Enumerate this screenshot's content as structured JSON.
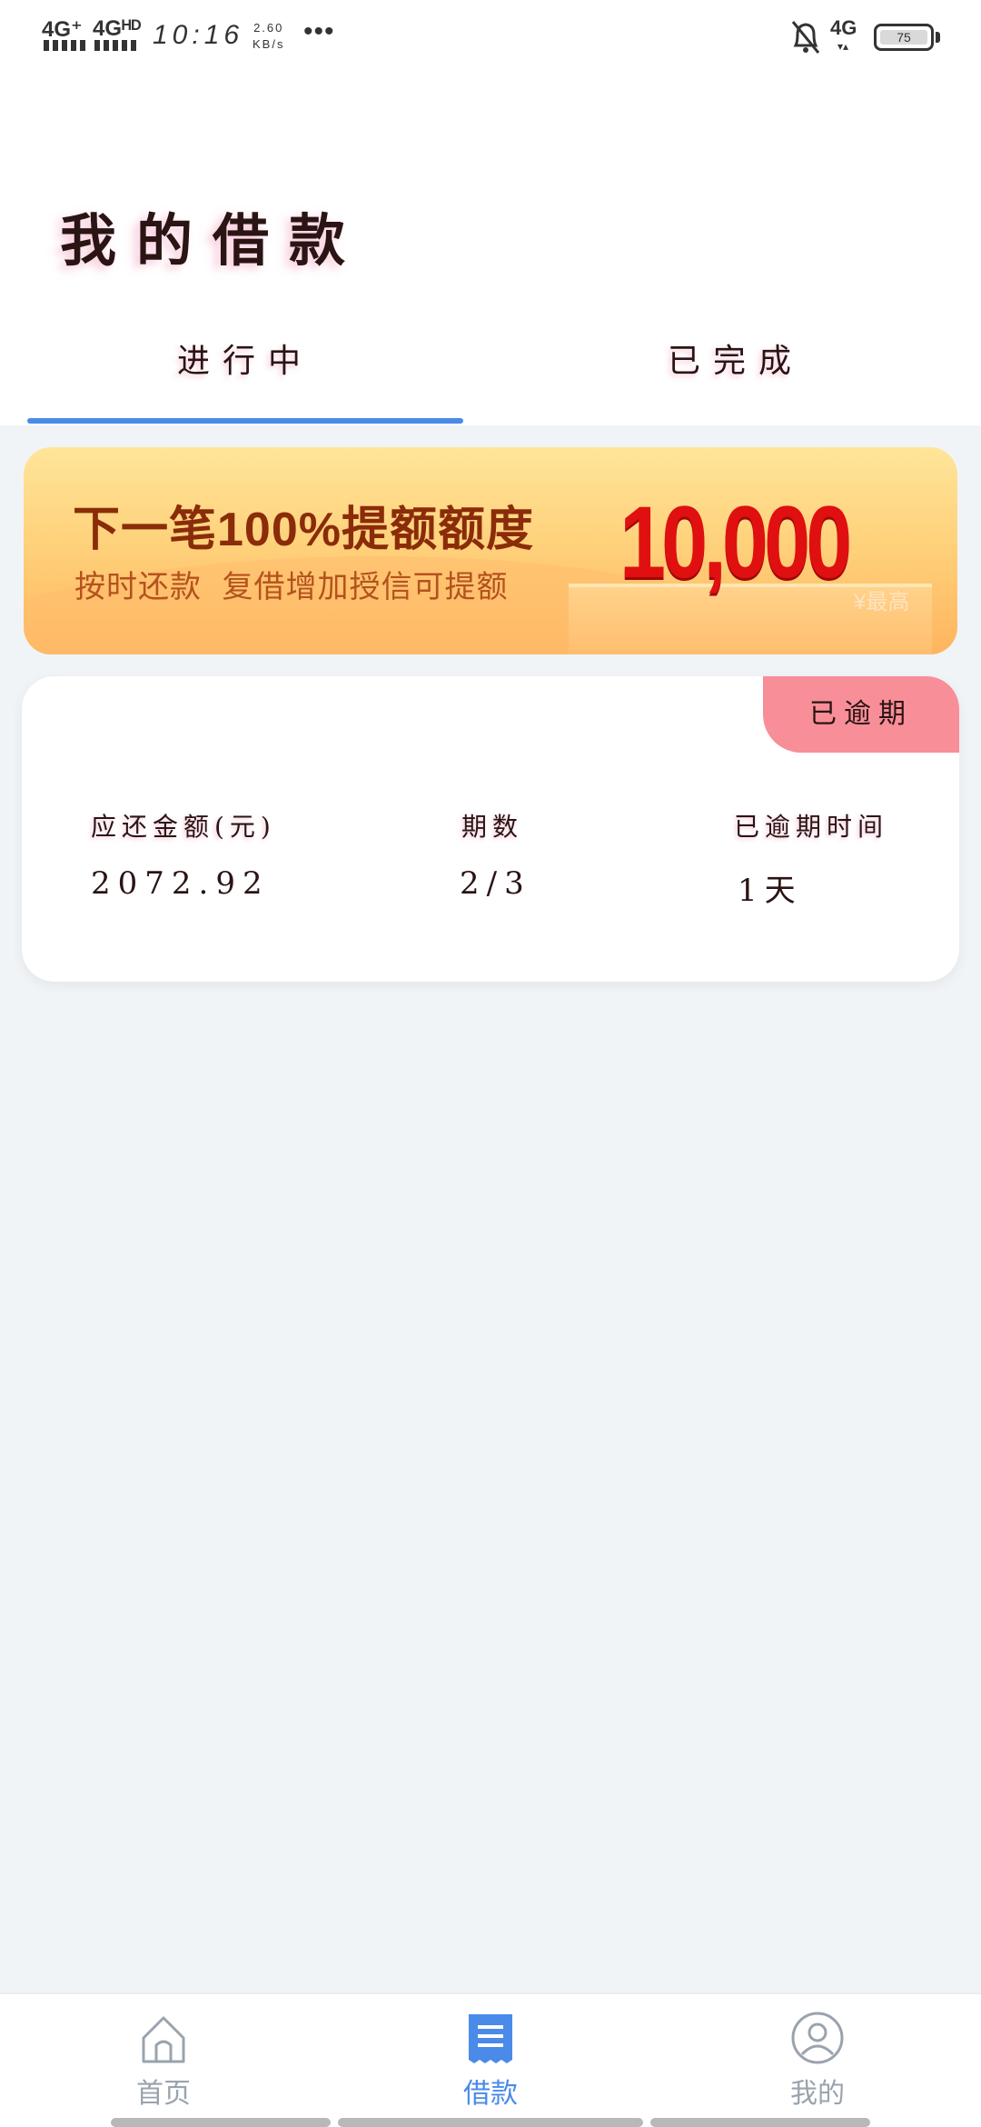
{
  "status_bar": {
    "signal1": "4G⁺",
    "signal2": "4Gᴴᴰ",
    "time": "10:16",
    "net_speed_value": "2.60",
    "net_speed_unit": "KB/s",
    "more": "•••",
    "network": "4G",
    "network_arrows": "▾▴",
    "battery": "75",
    "icons": [
      "signal-icon",
      "bell-off-icon",
      "battery-icon"
    ]
  },
  "header": {
    "title": "我的借款",
    "tabs": [
      {
        "label": "进行中",
        "active": true
      },
      {
        "label": "已完成",
        "active": false
      }
    ]
  },
  "banner": {
    "title": "下一笔100%提额额度",
    "subtitle": "按时还款 复借增加授信可提额",
    "amount": "10,000",
    "amount_caption": "¥最高"
  },
  "loan_card": {
    "status_badge": "已逾期",
    "columns": [
      {
        "label": "应还金额(元)",
        "value": "2072.92"
      },
      {
        "label": "期数",
        "value": "2/3"
      },
      {
        "label": "已逾期时间",
        "value": "1天"
      }
    ]
  },
  "bottom_nav": {
    "items": [
      {
        "label": "首页",
        "icon": "home-icon",
        "active": false
      },
      {
        "label": "借款",
        "icon": "loan-receipt-icon",
        "active": true
      },
      {
        "label": "我的",
        "icon": "profile-icon",
        "active": false
      }
    ]
  },
  "colors": {
    "accent": "#4a8ae8",
    "badge": "#f78e98",
    "banner_amount": "#e01010",
    "page_bg": "#f1f4f7"
  }
}
